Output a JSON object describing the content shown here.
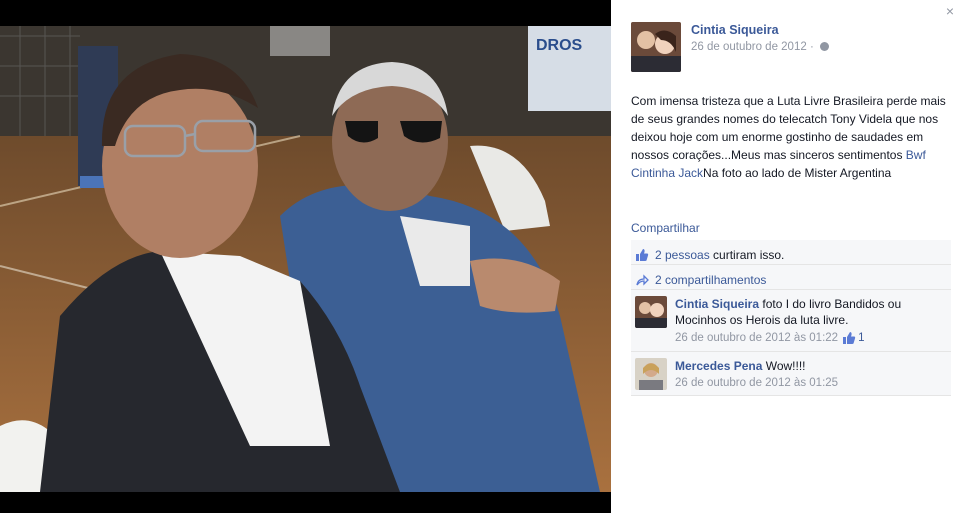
{
  "panel": {
    "close_glyph": "×",
    "author": "Cintia Siqueira",
    "date": "26 de outubro de 2012",
    "separator": "·",
    "privacy_icon": "globe-icon",
    "post_text_before_tag": "Com imensa tristeza que a Luta Livre Brasileira perde mais de seus grandes nomes do telecatch Tony Videla que nos deixou hoje com um enorme gostinho de saudades em nossos corações...Meus mas sinceros sentimentos ",
    "post_tag": "Bwf Cintinha Jack",
    "post_text_after_tag": "Na foto ao lado de Mister Argentina",
    "share_label": "Compartilhar",
    "likes_text": "2 pessoas",
    "likes_suffix": " curtiram isso.",
    "shares_text": "2 compartilhamentos",
    "comments": [
      {
        "name": "Cintia Siqueira",
        "text": " foto I do livro Bandidos ou Mocinhos os Herois da luta livre.",
        "time": "26 de outubro de 2012 às 01:22",
        "likes": "1"
      },
      {
        "name": "Mercedes Pena",
        "text": " Wow!!!!",
        "time": "26 de outubro de 2012 às 01:25",
        "likes": ""
      }
    ]
  },
  "photo": {
    "banner_text": "DROS"
  },
  "colors": {
    "link": "#3b5998",
    "muted": "#9197a3",
    "feedback_bg": "#f6f7f9"
  }
}
